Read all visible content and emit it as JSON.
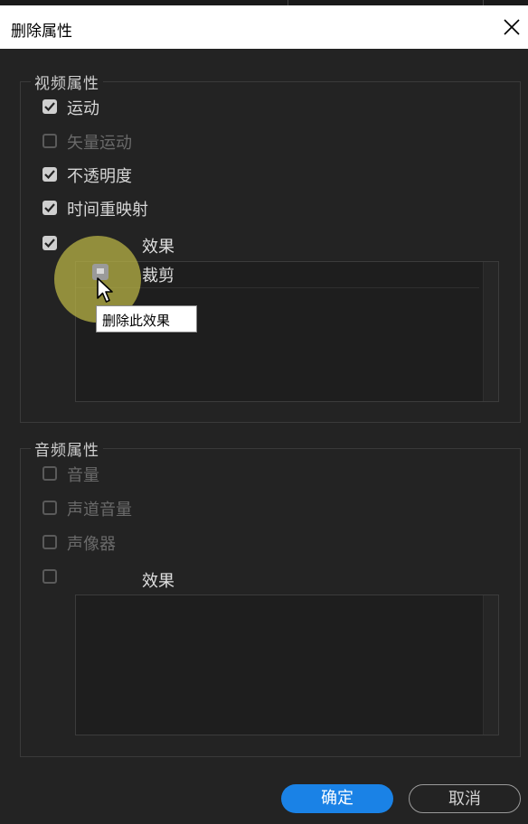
{
  "dialog": {
    "title": "删除属性",
    "ok_label": "确定",
    "cancel_label": "取消"
  },
  "video": {
    "title": "视频属性",
    "items": [
      {
        "label": "运动",
        "checked": true,
        "enabled": true
      },
      {
        "label": "矢量运动",
        "checked": false,
        "enabled": false
      },
      {
        "label": "不透明度",
        "checked": true,
        "enabled": true
      },
      {
        "label": "时间重映射",
        "checked": true,
        "enabled": true
      }
    ],
    "effects_label": "效果",
    "effects_checked": true,
    "effects_list": [
      {
        "label": "裁剪",
        "checked": true
      }
    ]
  },
  "audio": {
    "title": "音频属性",
    "items": [
      {
        "label": "音量",
        "checked": false,
        "enabled": false
      },
      {
        "label": "声道音量",
        "checked": false,
        "enabled": false
      },
      {
        "label": "声像器",
        "checked": false,
        "enabled": false
      }
    ],
    "effects_label": "效果",
    "effects_checked": false
  },
  "tooltip": {
    "text": "删除此效果"
  },
  "colors": {
    "accent": "#1a82e6",
    "background": "#232323",
    "highlight": "#bebb46"
  }
}
